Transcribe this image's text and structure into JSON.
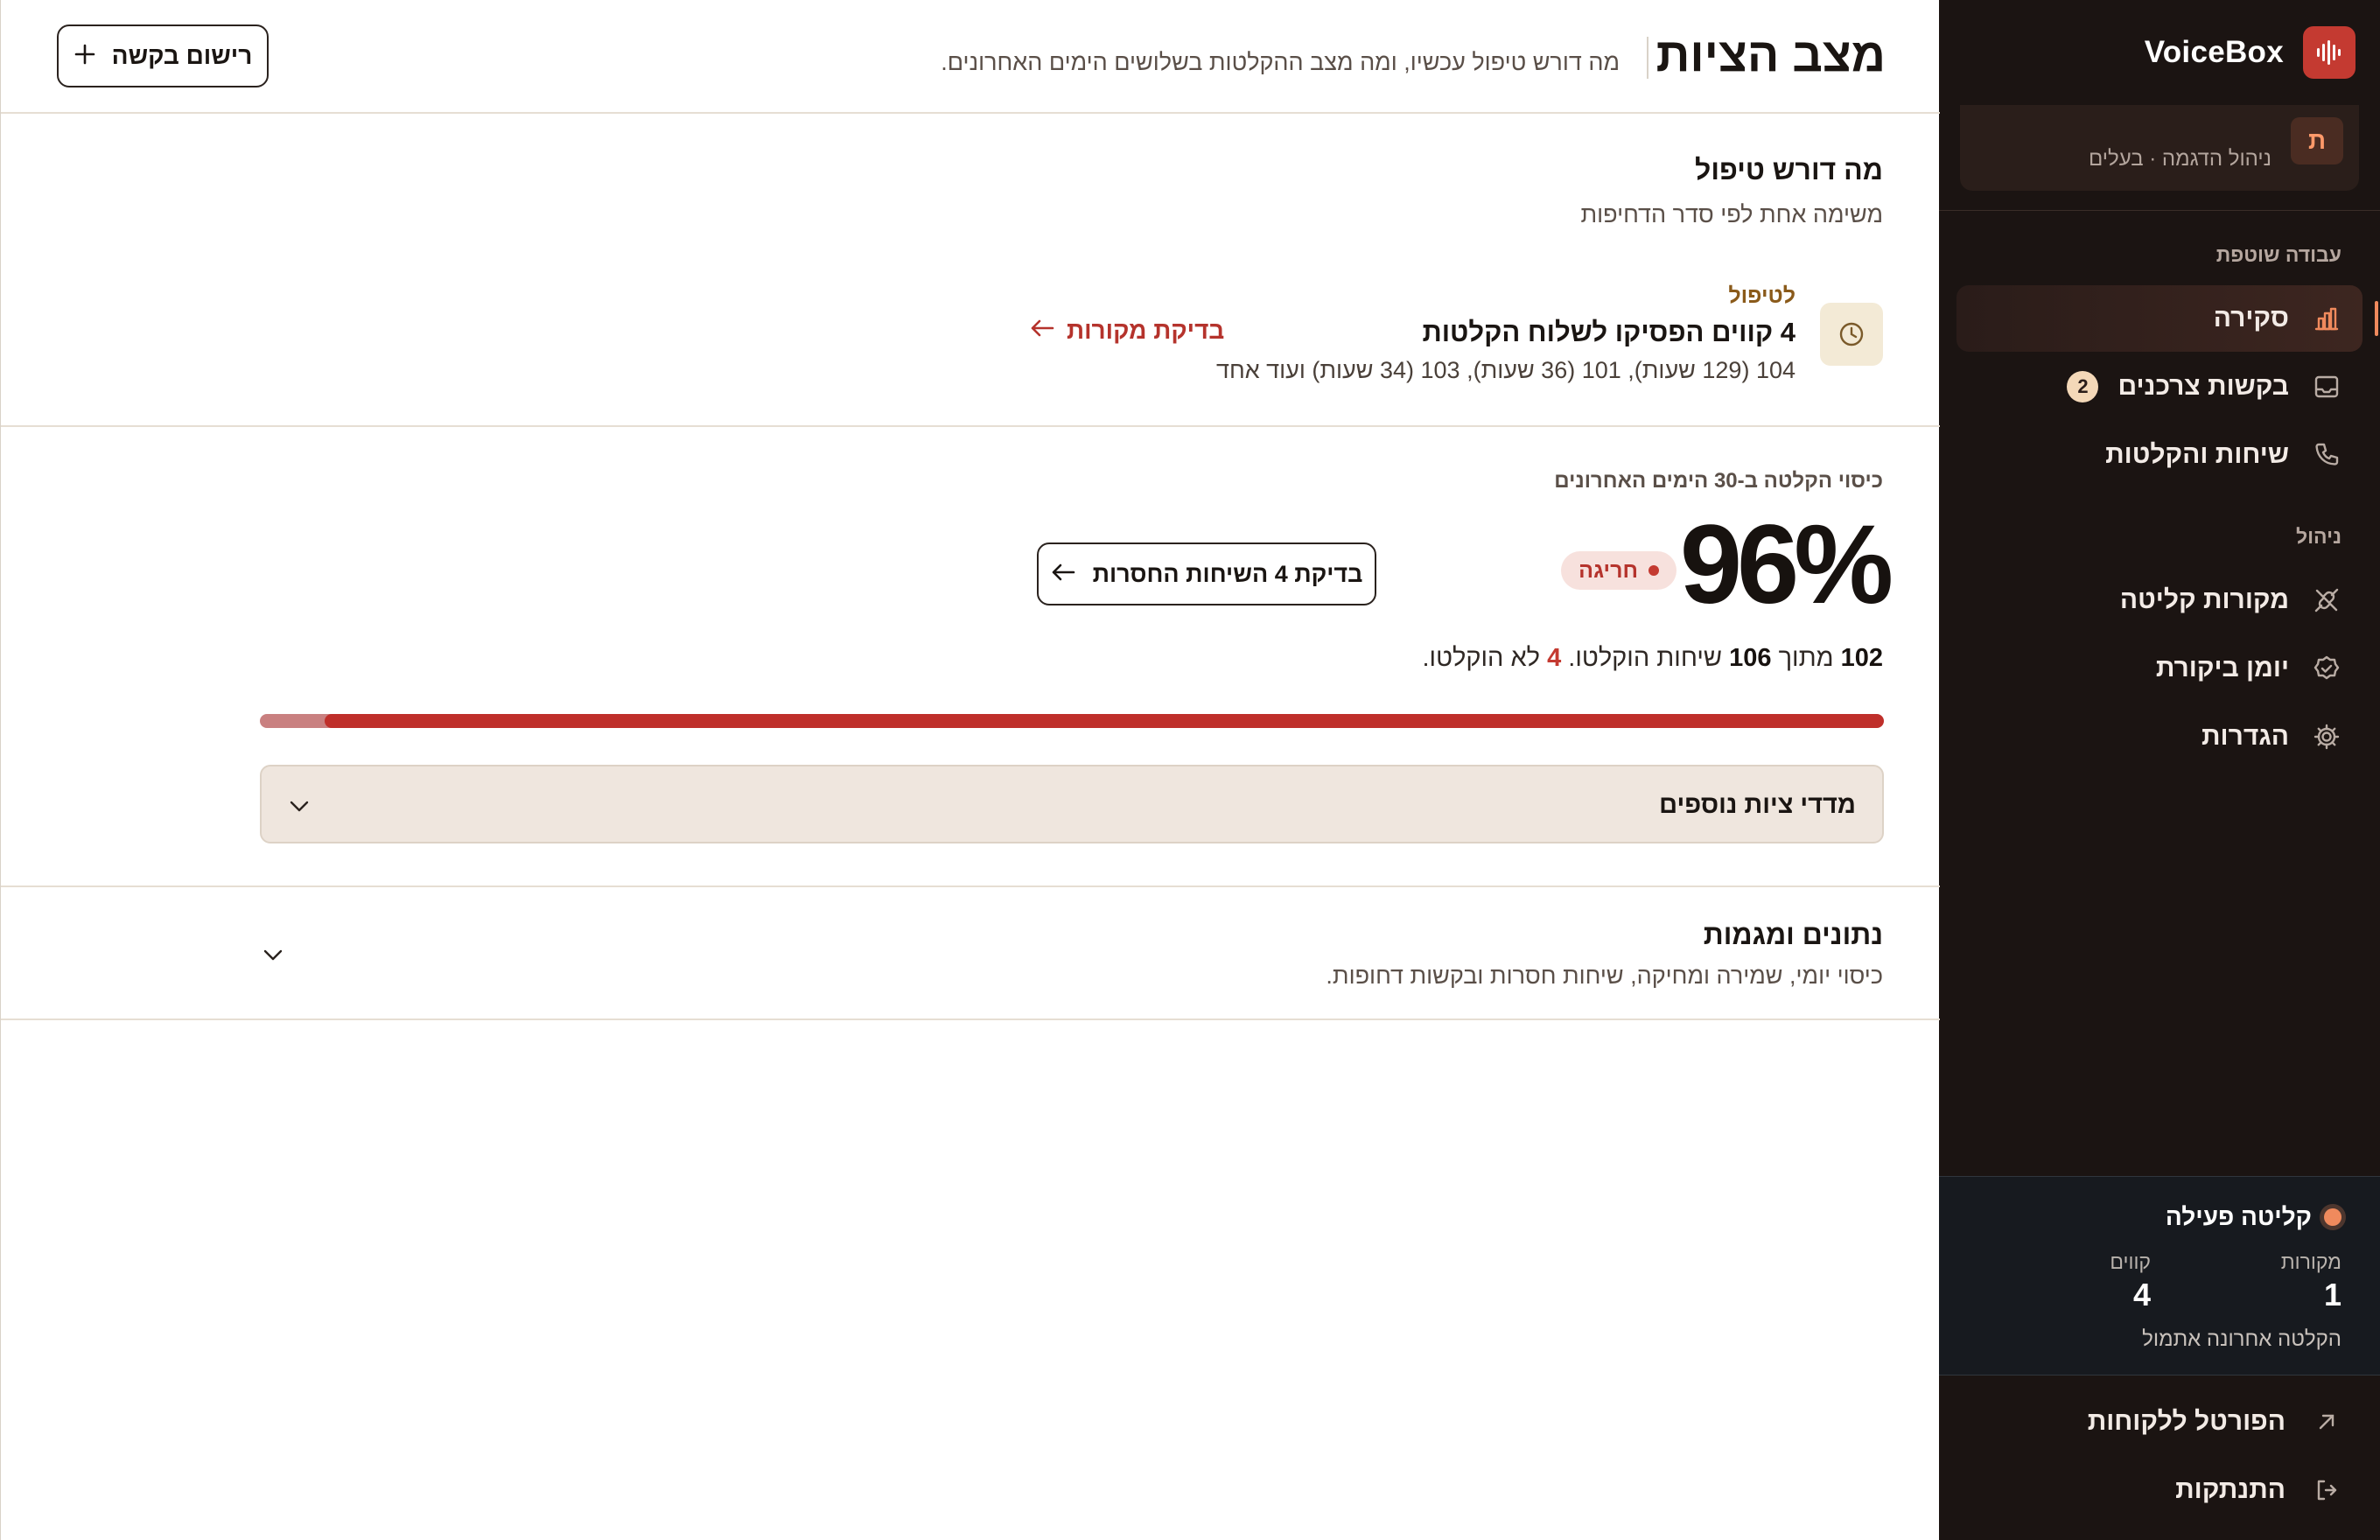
{
  "brand": {
    "name": "VoiceBox",
    "accent": "#c43a31"
  },
  "tenant": {
    "avatar_letter": "ת",
    "subtitle": "ניהול הדגמה · בעלים"
  },
  "sidebar": {
    "section_shared": "עבודה שוטפת",
    "section_manage": "ניהול",
    "items": [
      {
        "label": "סקירה",
        "icon": "bar-chart-icon",
        "active": true
      },
      {
        "label": "בקשות צרכנים",
        "icon": "inbox-icon",
        "badge": "2"
      },
      {
        "label": "שיחות והקלטות",
        "icon": "phone-icon"
      },
      {
        "label": "מקורות קליטה",
        "icon": "plug-off-icon"
      },
      {
        "label": "יומן ביקורת",
        "icon": "shield-check-icon"
      },
      {
        "label": "הגדרות",
        "icon": "gear-icon"
      }
    ],
    "ingest": {
      "title": "קליטה פעילה",
      "sources_label": "מקורות",
      "sources_value": "1",
      "lines_label": "קווים",
      "lines_value": "4",
      "last_ingest": "הקלטה אחרונה אתמול"
    },
    "portal_link": "הפורטל ללקוחות",
    "logout": "התנתקות"
  },
  "header": {
    "title": "מצב הציות",
    "subtitle": "מה דורש טיפול עכשיו, ומה מצב ההקלטות בשלושים הימים האחרונים.",
    "new_request_button": "רישום בקשה"
  },
  "attention": {
    "title": "מה דורש טיפול",
    "subtitle": "משימה אחת לפי סדר הדחיפות",
    "task": {
      "tag": "לטיפול",
      "title": "4 קווים הפסיקו לשלוח הקלטות",
      "detail": "104 (129 שעות), 101 (36 שעות), 103 (34 שעות) ועוד אחד",
      "link": "בדיקת מקורות"
    }
  },
  "coverage": {
    "label": "כיסוי הקלטה ב-30 הימים האחרונים",
    "percent_text": "96%",
    "percent": 96,
    "status_badge": "חריגה",
    "missing_button": "בדיקת 4 השיחות החסרות",
    "recorded": "102",
    "total": "106",
    "missing": "4",
    "text_of": "מתוך",
    "text_recorded": "שיחות הוקלטו.",
    "text_not_recorded": "לא הוקלטו.",
    "more_metrics": "מדדי ציות נוספים"
  },
  "trends": {
    "title": "נתונים ומגמות",
    "subtitle": "כיסוי יומי, שמירה ומחיקה, שיחות חסרות ובקשות דחופות."
  }
}
